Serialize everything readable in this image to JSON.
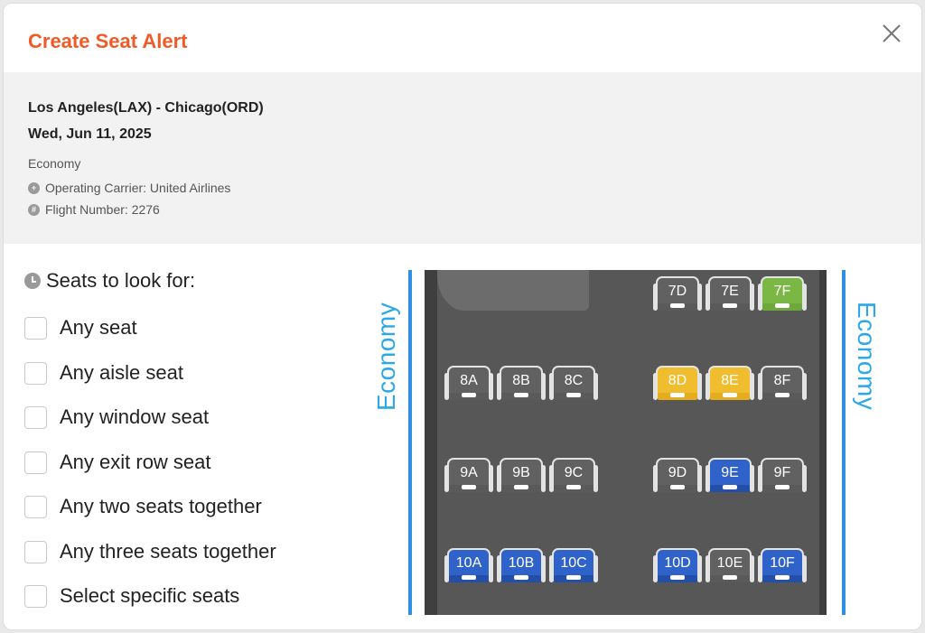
{
  "modal": {
    "title": "Create Seat Alert",
    "close_icon": "close-icon"
  },
  "flight": {
    "route": "Los Angeles(LAX) - Chicago(ORD)",
    "date": "Wed, Jun 11, 2025",
    "cabin": "Economy",
    "carrier": "Operating Carrier: United Airlines",
    "flight_number": "Flight Number: 2276"
  },
  "options": {
    "title": "Seats to look for:",
    "items": [
      {
        "label": "Any seat",
        "checked": false
      },
      {
        "label": "Any aisle seat",
        "checked": false
      },
      {
        "label": "Any window seat",
        "checked": false
      },
      {
        "label": "Any exit row seat",
        "checked": false
      },
      {
        "label": "Any two seats together",
        "checked": false
      },
      {
        "label": "Any three seats together",
        "checked": false
      },
      {
        "label": "Select specific seats",
        "checked": false
      }
    ]
  },
  "seatmap": {
    "section_label_left": "Economy",
    "section_label_right": "Economy",
    "colors": {
      "grey": "#616161",
      "green": "#7ab744",
      "yellow": "#f0bd2f",
      "blue": "#2f63c9",
      "section": "#2aa8e8"
    },
    "rows": [
      {
        "row": "7",
        "seats": [
          {
            "id": "7D",
            "status": "grey"
          },
          {
            "id": "7E",
            "status": "grey"
          },
          {
            "id": "7F",
            "status": "green"
          }
        ]
      },
      {
        "row": "8",
        "seats": [
          {
            "id": "8A",
            "status": "grey"
          },
          {
            "id": "8B",
            "status": "grey"
          },
          {
            "id": "8C",
            "status": "grey"
          },
          {
            "id": "8D",
            "status": "yellow"
          },
          {
            "id": "8E",
            "status": "yellow"
          },
          {
            "id": "8F",
            "status": "grey"
          }
        ]
      },
      {
        "row": "9",
        "seats": [
          {
            "id": "9A",
            "status": "grey"
          },
          {
            "id": "9B",
            "status": "grey"
          },
          {
            "id": "9C",
            "status": "grey"
          },
          {
            "id": "9D",
            "status": "grey"
          },
          {
            "id": "9E",
            "status": "blue"
          },
          {
            "id": "9F",
            "status": "grey"
          }
        ]
      },
      {
        "row": "10",
        "seats": [
          {
            "id": "10A",
            "status": "blue"
          },
          {
            "id": "10B",
            "status": "blue"
          },
          {
            "id": "10C",
            "status": "blue"
          },
          {
            "id": "10D",
            "status": "blue"
          },
          {
            "id": "10E",
            "status": "grey"
          },
          {
            "id": "10F",
            "status": "blue"
          }
        ]
      }
    ]
  }
}
